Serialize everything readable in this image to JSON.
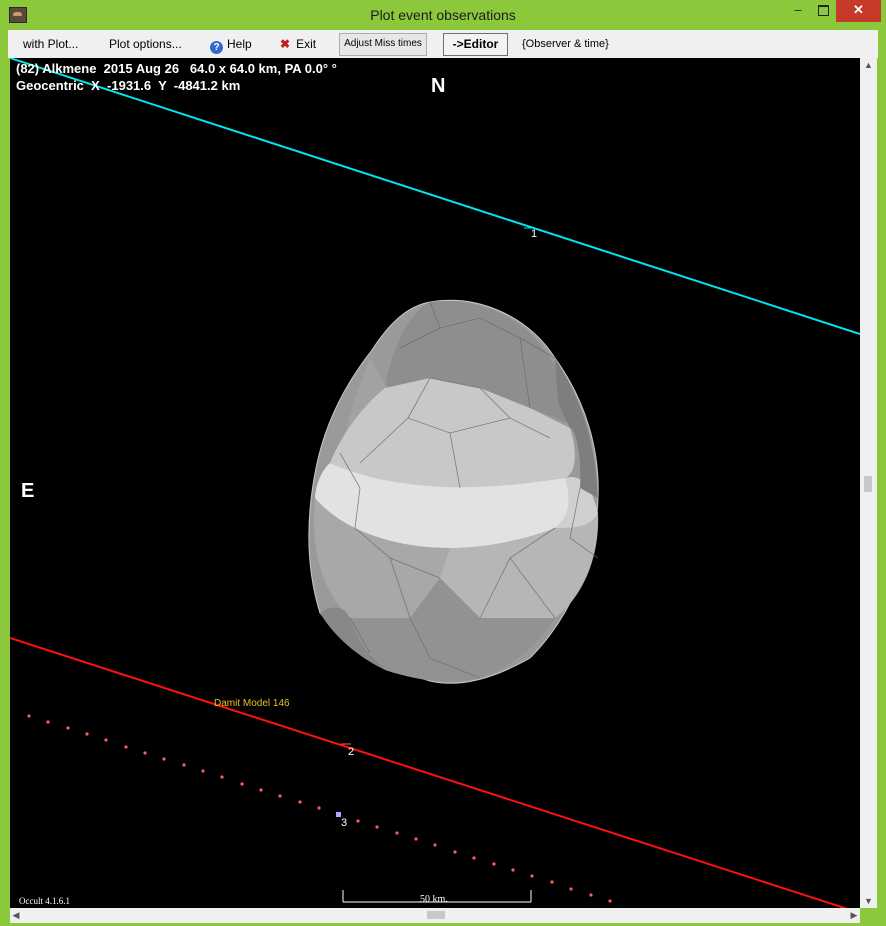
{
  "window": {
    "title": "Plot event observations",
    "minimize_label": "–",
    "close_label": "✕"
  },
  "menu": {
    "with_plot": "with Plot...",
    "plot_options": "Plot options...",
    "help": "Help",
    "help_icon_glyph": "?",
    "exit": "Exit",
    "exit_icon_glyph": "✖",
    "adjust_miss_times": "Adjust Miss times",
    "editor": "->Editor",
    "observer_time": "{Observer & time}"
  },
  "plot": {
    "header_line1": "(82) Alkmene  2015 Aug 26   64.0 x 64.0 km, PA 0.0° °",
    "header_line2": "Geocentric  X  -1931.6  Y  -4841.2 km",
    "north_label": "N",
    "east_label": "E",
    "model_label": "Damit Model 146",
    "scale_label": "50 km.",
    "version": "Occult 4.1.6.1",
    "chords": [
      {
        "number": "1",
        "color": "#00e5ee"
      },
      {
        "number": "2",
        "color": "#ff1010"
      },
      {
        "number": "3",
        "color": "#ff5a5a"
      }
    ],
    "colors": {
      "background": "#000000",
      "chord1": "#00e5ee",
      "chord2": "#ff1010",
      "chord3_dots": "#ff5a5a",
      "model_label": "#e8c020",
      "asteroid": "#a8a8a8"
    }
  }
}
